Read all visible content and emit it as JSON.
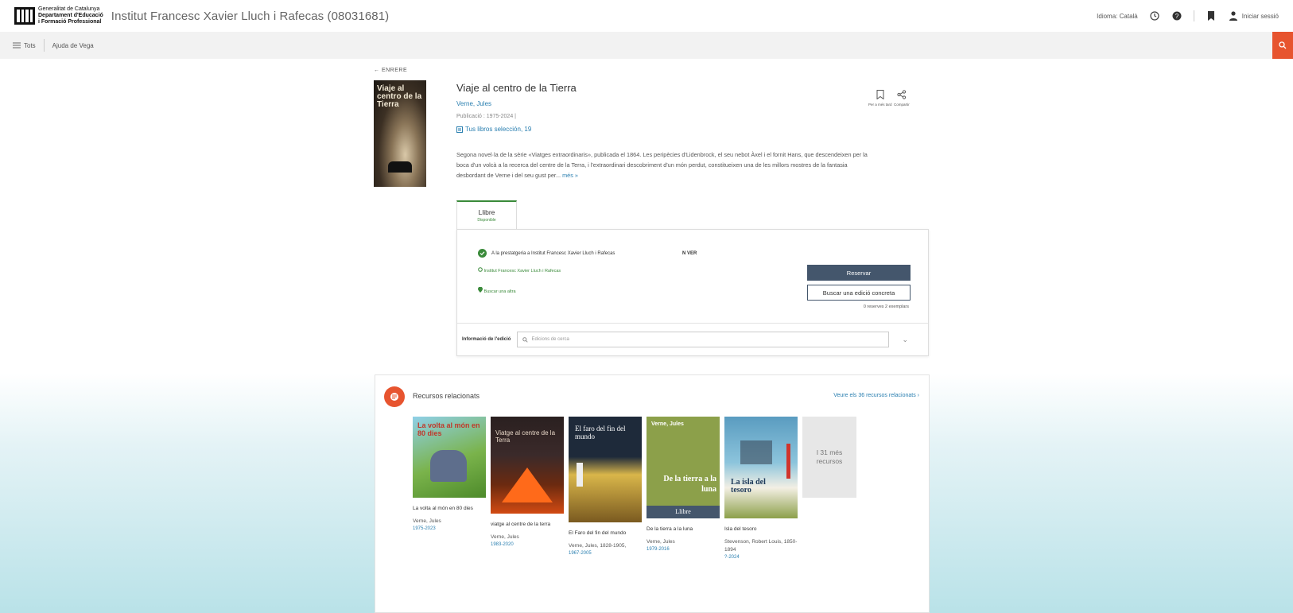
{
  "header": {
    "gencat_line1": "Generalitat de Catalunya",
    "gencat_line2": "Departament d'Educació",
    "gencat_line3": "i Formació Professional",
    "site_title": "Institut Francesc Xavier Lluch i Rafecas (08031681)",
    "language": "Idioma: Català",
    "login": "Iniciar sessió"
  },
  "nav": {
    "menu": "Tots",
    "help": "Ajuda de Vega"
  },
  "book": {
    "back": "ENRERE",
    "cover_text": "Viaje al centro de la Tierra",
    "title": "Viaje al centro de la Tierra",
    "author": "Verne, Jules",
    "published": "Publicació : 1975-2024 |",
    "list": "Tus libros selección, 19",
    "description": "Segona novel·la de la sèrie «Viatges extraordinaris», publicada el 1864. Les peripècies d'Lidenbrock, el seu nebot Àxel i el fornit Hans, que descendeixen per la boca d'un volcà a la recerca del centre de la Terra, i l'extraordinari descobriment d'un món perdut, constitueixen una de les millors mostres de la fantasia desbordant de Verne i del seu gust per...",
    "more": "més »",
    "save_label": "Per a més tard",
    "share_label": "Compartir"
  },
  "availability": {
    "tab_title": "Llibre",
    "tab_status": "Disponible",
    "status_text": "A la prestatgeria a Institut Francesc Xavier Lluch i Rafecas",
    "call_number": "N VER",
    "institution": "Institut Francesc Xavier Lluch i Rafecas",
    "find_other": "Buscar una altra",
    "reserve": "Reservar",
    "search_edition": "Buscar una edició concreta",
    "counts": "0 reserves  2 exemplars",
    "edition_label": "Informació de l'edició",
    "edition_placeholder": "Edicions de cerca"
  },
  "related": {
    "title": "Recursos relacionats",
    "see_all": "Veure els 36 recursos relacionats ›",
    "items": [
      {
        "name": "La volta al món en 80 dies",
        "author": "Verne, Jules",
        "years": "1975-2023",
        "cover_text": "La volta al món en 80 dies",
        "color": "#7ab34b"
      },
      {
        "name": "viatge al centre de la terra",
        "author": "Verne, Jules",
        "years": "1983-2020",
        "cover_text": "Viatge al centre de la Terra",
        "color": "#3b2a2a"
      },
      {
        "name": "El Faro del fin del mundo",
        "author": "Verne, Jules, 1828-1905,",
        "years": "1967-2005",
        "cover_text": "El faro del fin del mundo",
        "color": "#1e2a3a"
      },
      {
        "name": "De la tierra a la luna",
        "author": "Verne, Jules",
        "years": "1979-2016",
        "cover_text": "De la tierra a la luna",
        "cover_author": "Verne, Jules",
        "cover_band": "Llibre",
        "color": "#8ca04a"
      },
      {
        "name": "Isla del tesoro",
        "author": "Stevenson, Robert Louis, 1850-1894",
        "years": "?-2024",
        "cover_text": "La isla del tesoro",
        "color": "#5a9cc0"
      }
    ],
    "more_tile": "I 31 més recursos"
  },
  "colors": {
    "accent": "#e7542f",
    "link": "#2a7fb0",
    "available": "#3a8a3a",
    "primary_button": "#44566c"
  }
}
